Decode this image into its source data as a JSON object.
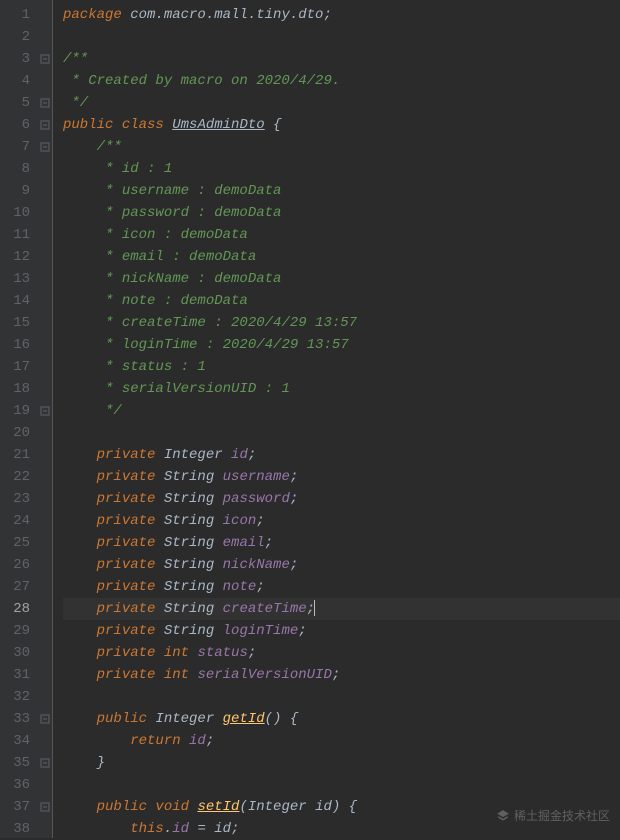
{
  "editor": {
    "current_line": 28,
    "lines": [
      {
        "n": 1,
        "fold": "",
        "tokens": [
          {
            "t": "package ",
            "c": "kw"
          },
          {
            "t": "com.macro.mall.tiny.dto",
            "c": "str-pkg"
          },
          {
            "t": ";",
            "c": "ident"
          }
        ]
      },
      {
        "n": 2,
        "fold": "",
        "tokens": []
      },
      {
        "n": 3,
        "fold": "open",
        "tokens": [
          {
            "t": "/**",
            "c": "doc"
          }
        ]
      },
      {
        "n": 4,
        "fold": "",
        "tokens": [
          {
            "t": " * Created by macro on 2020/4/29.",
            "c": "doc"
          }
        ]
      },
      {
        "n": 5,
        "fold": "close",
        "tokens": [
          {
            "t": " */",
            "c": "doc"
          }
        ]
      },
      {
        "n": 6,
        "fold": "open",
        "tokens": [
          {
            "t": "public ",
            "c": "kw"
          },
          {
            "t": "class ",
            "c": "kw"
          },
          {
            "t": "UmsAdminDto",
            "c": "ident underline"
          },
          {
            "t": " {",
            "c": "ident"
          }
        ]
      },
      {
        "n": 7,
        "fold": "open",
        "indent": 1,
        "tokens": [
          {
            "t": "/**",
            "c": "doc"
          }
        ]
      },
      {
        "n": 8,
        "fold": "",
        "indent": 1,
        "tokens": [
          {
            "t": " * id : 1",
            "c": "doc"
          }
        ]
      },
      {
        "n": 9,
        "fold": "",
        "indent": 1,
        "tokens": [
          {
            "t": " * username : demoData",
            "c": "doc"
          }
        ]
      },
      {
        "n": 10,
        "fold": "",
        "indent": 1,
        "tokens": [
          {
            "t": " * password : demoData",
            "c": "doc"
          }
        ]
      },
      {
        "n": 11,
        "fold": "",
        "indent": 1,
        "tokens": [
          {
            "t": " * icon : demoData",
            "c": "doc"
          }
        ]
      },
      {
        "n": 12,
        "fold": "",
        "indent": 1,
        "tokens": [
          {
            "t": " * email : demoData",
            "c": "doc"
          }
        ]
      },
      {
        "n": 13,
        "fold": "",
        "indent": 1,
        "tokens": [
          {
            "t": " * nickName : demoData",
            "c": "doc"
          }
        ]
      },
      {
        "n": 14,
        "fold": "",
        "indent": 1,
        "tokens": [
          {
            "t": " * note : demoData",
            "c": "doc"
          }
        ]
      },
      {
        "n": 15,
        "fold": "",
        "indent": 1,
        "tokens": [
          {
            "t": " * createTime : 2020/4/29 13:57",
            "c": "doc"
          }
        ]
      },
      {
        "n": 16,
        "fold": "",
        "indent": 1,
        "tokens": [
          {
            "t": " * loginTime : 2020/4/29 13:57",
            "c": "doc"
          }
        ]
      },
      {
        "n": 17,
        "fold": "",
        "indent": 1,
        "tokens": [
          {
            "t": " * status : 1",
            "c": "doc"
          }
        ]
      },
      {
        "n": 18,
        "fold": "",
        "indent": 1,
        "tokens": [
          {
            "t": " * serialVersionUID : 1",
            "c": "doc"
          }
        ]
      },
      {
        "n": 19,
        "fold": "close",
        "indent": 1,
        "tokens": [
          {
            "t": " */",
            "c": "doc"
          }
        ]
      },
      {
        "n": 20,
        "fold": "",
        "tokens": []
      },
      {
        "n": 21,
        "fold": "",
        "indent": 1,
        "tokens": [
          {
            "t": "private ",
            "c": "kw"
          },
          {
            "t": "Integer ",
            "c": "type"
          },
          {
            "t": "id",
            "c": "field"
          },
          {
            "t": ";",
            "c": "ident"
          }
        ]
      },
      {
        "n": 22,
        "fold": "",
        "indent": 1,
        "tokens": [
          {
            "t": "private ",
            "c": "kw"
          },
          {
            "t": "String ",
            "c": "type"
          },
          {
            "t": "username",
            "c": "field"
          },
          {
            "t": ";",
            "c": "ident"
          }
        ]
      },
      {
        "n": 23,
        "fold": "",
        "indent": 1,
        "tokens": [
          {
            "t": "private ",
            "c": "kw"
          },
          {
            "t": "String ",
            "c": "type"
          },
          {
            "t": "password",
            "c": "field"
          },
          {
            "t": ";",
            "c": "ident"
          }
        ]
      },
      {
        "n": 24,
        "fold": "",
        "indent": 1,
        "tokens": [
          {
            "t": "private ",
            "c": "kw"
          },
          {
            "t": "String ",
            "c": "type"
          },
          {
            "t": "icon",
            "c": "field"
          },
          {
            "t": ";",
            "c": "ident"
          }
        ]
      },
      {
        "n": 25,
        "fold": "",
        "indent": 1,
        "tokens": [
          {
            "t": "private ",
            "c": "kw"
          },
          {
            "t": "String ",
            "c": "type"
          },
          {
            "t": "email",
            "c": "field"
          },
          {
            "t": ";",
            "c": "ident"
          }
        ]
      },
      {
        "n": 26,
        "fold": "",
        "indent": 1,
        "tokens": [
          {
            "t": "private ",
            "c": "kw"
          },
          {
            "t": "String ",
            "c": "type"
          },
          {
            "t": "nickName",
            "c": "field"
          },
          {
            "t": ";",
            "c": "ident"
          }
        ]
      },
      {
        "n": 27,
        "fold": "",
        "indent": 1,
        "tokens": [
          {
            "t": "private ",
            "c": "kw"
          },
          {
            "t": "String ",
            "c": "type"
          },
          {
            "t": "note",
            "c": "field"
          },
          {
            "t": ";",
            "c": "ident"
          }
        ]
      },
      {
        "n": 28,
        "fold": "",
        "indent": 1,
        "tokens": [
          {
            "t": "private ",
            "c": "kw"
          },
          {
            "t": "String ",
            "c": "type"
          },
          {
            "t": "createTime",
            "c": "field"
          },
          {
            "t": ";",
            "c": "ident"
          }
        ],
        "caret": true
      },
      {
        "n": 29,
        "fold": "",
        "indent": 1,
        "tokens": [
          {
            "t": "private ",
            "c": "kw"
          },
          {
            "t": "String ",
            "c": "type"
          },
          {
            "t": "loginTime",
            "c": "field"
          },
          {
            "t": ";",
            "c": "ident"
          }
        ]
      },
      {
        "n": 30,
        "fold": "",
        "indent": 1,
        "tokens": [
          {
            "t": "private ",
            "c": "kw"
          },
          {
            "t": "int ",
            "c": "kw"
          },
          {
            "t": "status",
            "c": "field"
          },
          {
            "t": ";",
            "c": "ident"
          }
        ]
      },
      {
        "n": 31,
        "fold": "",
        "indent": 1,
        "tokens": [
          {
            "t": "private ",
            "c": "kw"
          },
          {
            "t": "int ",
            "c": "kw"
          },
          {
            "t": "serialVersionUID",
            "c": "field"
          },
          {
            "t": ";",
            "c": "ident"
          }
        ]
      },
      {
        "n": 32,
        "fold": "",
        "tokens": []
      },
      {
        "n": 33,
        "fold": "open",
        "indent": 1,
        "tokens": [
          {
            "t": "public ",
            "c": "kw"
          },
          {
            "t": "Integer ",
            "c": "type"
          },
          {
            "t": "getId",
            "c": "method underline"
          },
          {
            "t": "() {",
            "c": "ident"
          }
        ]
      },
      {
        "n": 34,
        "fold": "",
        "indent": 2,
        "tokens": [
          {
            "t": "return ",
            "c": "kw"
          },
          {
            "t": "id",
            "c": "field"
          },
          {
            "t": ";",
            "c": "ident"
          }
        ]
      },
      {
        "n": 35,
        "fold": "close",
        "indent": 1,
        "tokens": [
          {
            "t": "}",
            "c": "ident"
          }
        ]
      },
      {
        "n": 36,
        "fold": "",
        "tokens": []
      },
      {
        "n": 37,
        "fold": "open",
        "indent": 1,
        "tokens": [
          {
            "t": "public ",
            "c": "kw"
          },
          {
            "t": "void ",
            "c": "kw"
          },
          {
            "t": "setId",
            "c": "method underline"
          },
          {
            "t": "(Integer id) {",
            "c": "ident"
          }
        ]
      },
      {
        "n": 38,
        "fold": "",
        "indent": 2,
        "tokens": [
          {
            "t": "this",
            "c": "kw"
          },
          {
            "t": ".",
            "c": "ident"
          },
          {
            "t": "id",
            "c": "field"
          },
          {
            "t": " = id;",
            "c": "ident"
          }
        ]
      }
    ]
  },
  "watermark": {
    "text": "稀土掘金技术社区"
  }
}
